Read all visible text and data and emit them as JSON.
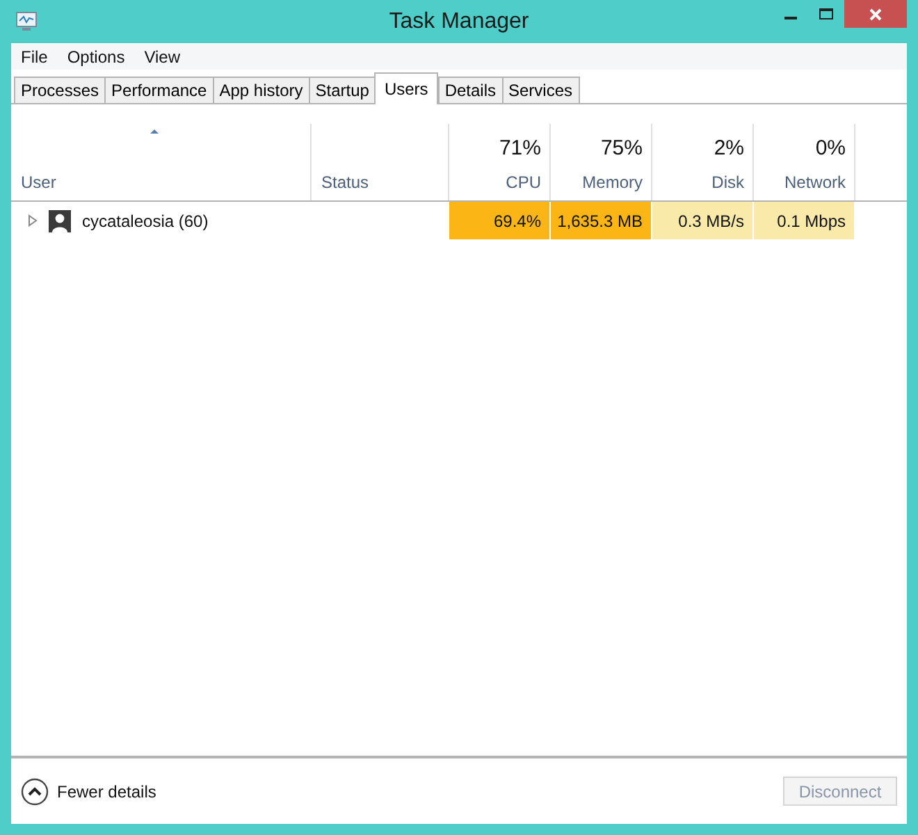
{
  "window": {
    "title": "Task Manager"
  },
  "menu": [
    "File",
    "Options",
    "View"
  ],
  "tabs": [
    {
      "label": "Processes",
      "selected": false
    },
    {
      "label": "Performance",
      "selected": false
    },
    {
      "label": "App history",
      "selected": false
    },
    {
      "label": "Startup",
      "selected": false
    },
    {
      "label": "Users",
      "selected": true
    },
    {
      "label": "Details",
      "selected": false
    },
    {
      "label": "Services",
      "selected": false
    }
  ],
  "table": {
    "columns": [
      {
        "label": "User",
        "sorted": true
      },
      {
        "label": "Status",
        "sorted": false
      },
      {
        "label": "CPU",
        "summary": "71%",
        "sorted": false
      },
      {
        "label": "Memory",
        "summary": "75%",
        "sorted": false
      },
      {
        "label": "Disk",
        "summary": "2%",
        "sorted": false
      },
      {
        "label": "Network",
        "summary": "0%",
        "sorted": false
      }
    ],
    "rows": [
      {
        "cells": [
          {
            "text": "cycataleosia (60)",
            "expanded": false
          },
          {
            "text": ""
          },
          {
            "text": "69.4%",
            "color": "#fbb515"
          },
          {
            "text": "1,635.3 MB",
            "color": "#fbb515"
          },
          {
            "text": "0.3 MB/s",
            "color": "#f9eaa9"
          },
          {
            "text": "0.1 Mbps",
            "color": "#f9eaa9"
          }
        ]
      }
    ]
  },
  "footer": {
    "toggle": "Fewer details",
    "button": {
      "label": "Disconnect",
      "disabled": true
    }
  }
}
